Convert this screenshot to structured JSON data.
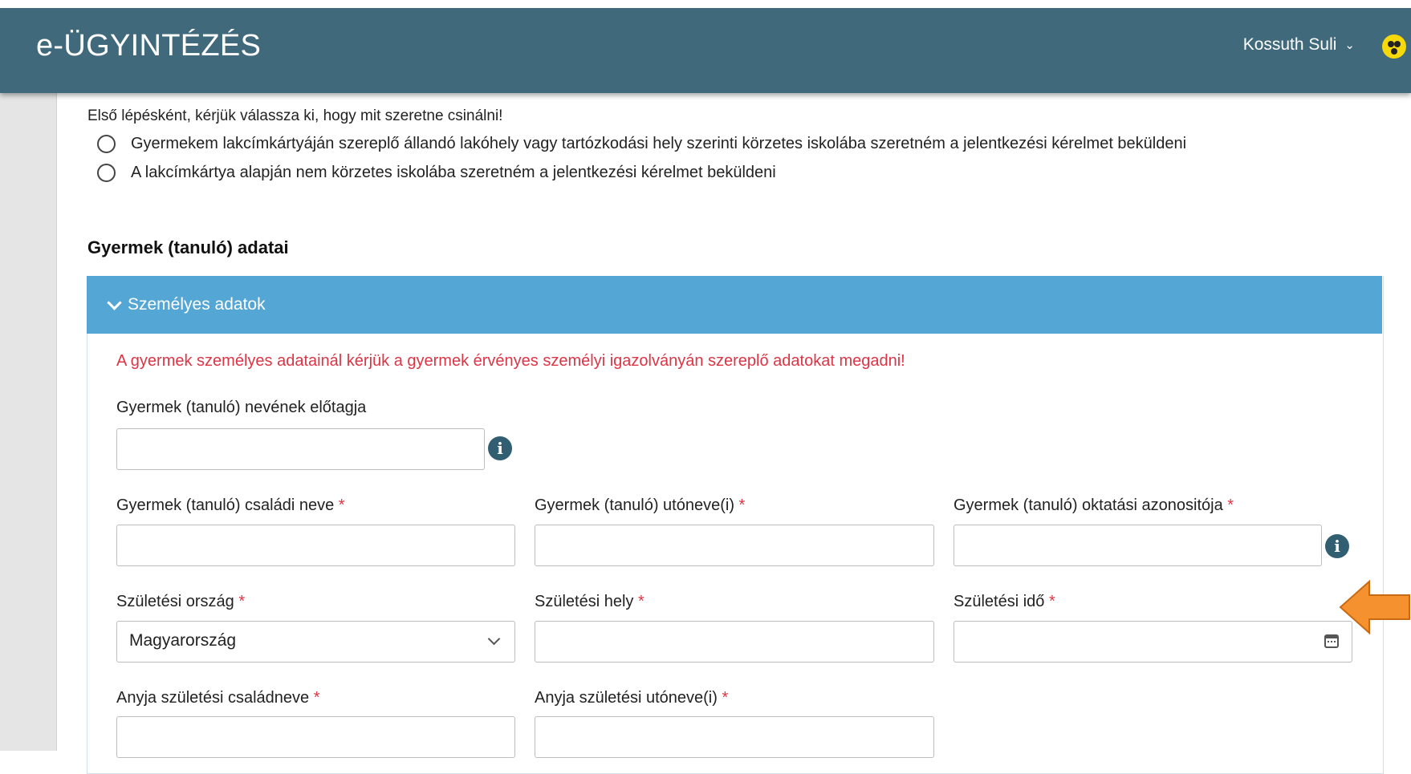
{
  "header": {
    "title": "e-ÜGYINTÉZÉS",
    "user_name": "Kossuth Suli"
  },
  "intro": "Első lépésként, kérjük válassza ki, hogy mit szeretne csinálni!",
  "radio_options": [
    {
      "label": "Gyermekem lakcímkártyáján szereplő állandó lakóhely vagy tartózkodási hely szerinti körzetes iskolába szeretném a jelentkezési kérelmet beküldeni",
      "selected": false
    },
    {
      "label": "A lakcímkártya alapján nem körzetes iskolába szeretném a jelentkezési kérelmet beküldeni",
      "selected": false
    }
  ],
  "section_title": "Gyermek (tanuló) adatai",
  "panel": {
    "title": "Személyes adatok",
    "notice": "A gyermek személyes adatainál kérjük a gyermek érvényes személyi igazolványán szereplő adatokat megadni!"
  },
  "fields": {
    "name_prefix": {
      "label": "Gyermek (tanuló) nevének előtagja",
      "value": ""
    },
    "family_name": {
      "label": "Gyermek (tanuló) családi neve",
      "value": ""
    },
    "given_names": {
      "label": "Gyermek (tanuló) utóneve(i)",
      "value": ""
    },
    "education_id": {
      "label": "Gyermek (tanuló) oktatási azonositója",
      "value": ""
    },
    "birth_country": {
      "label": "Születési ország",
      "value": "Magyarország"
    },
    "birth_place": {
      "label": "Születési hely",
      "value": ""
    },
    "birth_date": {
      "label": "Születési idő",
      "value": ""
    },
    "mother_family_name": {
      "label": "Anyja születési családneve",
      "value": ""
    },
    "mother_given_names": {
      "label": "Anyja születési utóneve(i)",
      "value": ""
    }
  },
  "required_mark": "*",
  "info_glyph": "i",
  "colors": {
    "header_bg": "#406a7c",
    "panel_header_bg": "#54a6d4",
    "required": "#dc3545",
    "annotation_arrow": "#f5922f"
  },
  "icons": [
    "chevron-down-icon",
    "accessibility-icon",
    "info-icon",
    "calendar-icon",
    "annotation-arrow-icon"
  ]
}
